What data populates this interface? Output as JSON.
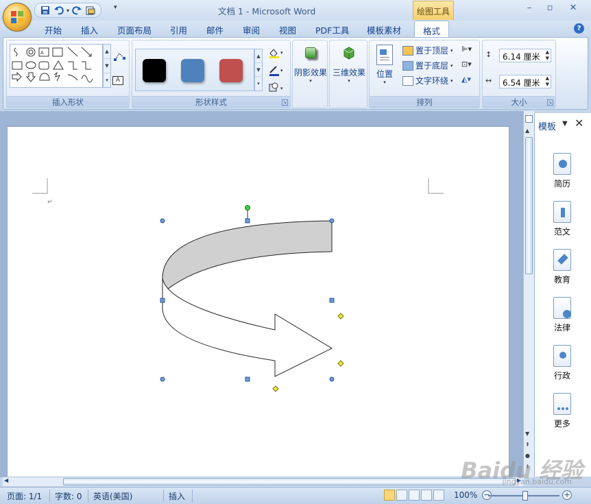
{
  "window": {
    "title": "文档 1 - Microsoft Word",
    "context_tab": "绘图工具"
  },
  "tabs": [
    "开始",
    "插入",
    "页面布局",
    "引用",
    "邮件",
    "审阅",
    "视图",
    "PDF工具",
    "模板素材",
    "格式"
  ],
  "active_tab": "格式",
  "ribbon": {
    "groups": {
      "insert_shapes": "插入形状",
      "shape_styles": "形状样式",
      "arrange": "排列",
      "size": "大小"
    },
    "style_swatches": [
      "#000000",
      "#4f81bd",
      "#c0504d"
    ],
    "shadow_effect": "阴影效果",
    "threed_effect": "三维效果",
    "position": "位置",
    "bring_to_front": "置于顶层",
    "send_to_back": "置于底层",
    "text_wrap": "文字环绕",
    "height_value": "6.14 厘米",
    "width_value": "6.54 厘米"
  },
  "pane": {
    "title": "模板",
    "items": [
      "简历",
      "范文",
      "教育",
      "法律",
      "行政",
      "更多"
    ]
  },
  "status": {
    "page": "页面: 1/1",
    "words": "字数: 0",
    "language": "英语(美国)",
    "mode": "插入",
    "zoom": "100%"
  },
  "watermark": {
    "text": "Baidu 经验",
    "sub": "jingyan.baidu.com"
  }
}
